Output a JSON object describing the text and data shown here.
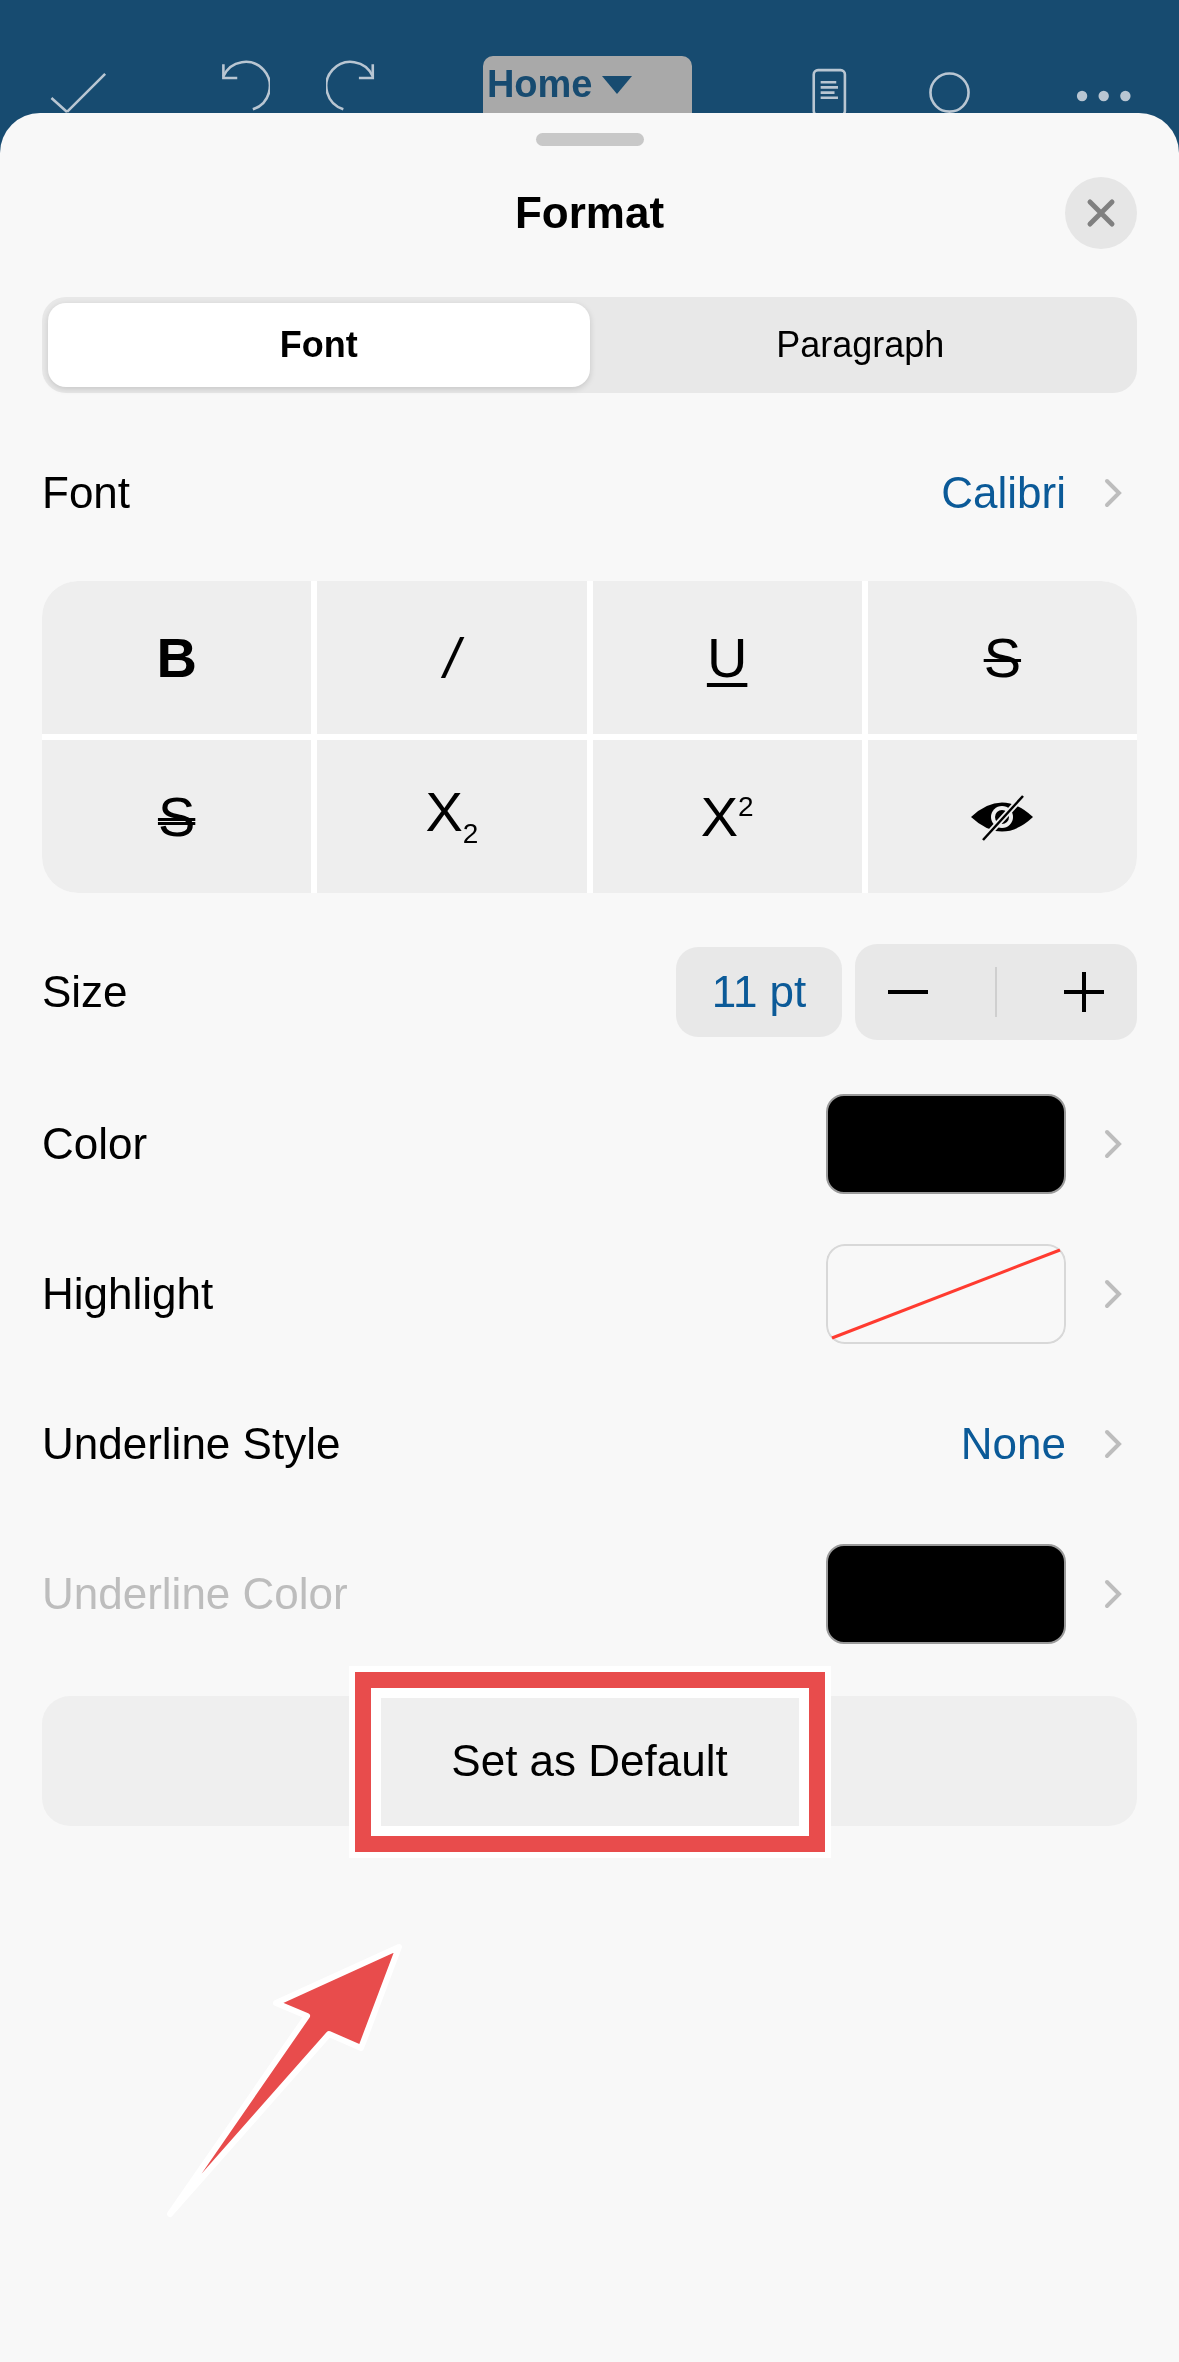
{
  "toolbar": {
    "menu": {
      "label": "Home"
    }
  },
  "sheet": {
    "title": "Format",
    "tabs": [
      {
        "label": "Font",
        "selected": true
      },
      {
        "label": "Paragraph",
        "selected": false
      }
    ],
    "font": {
      "label": "Font",
      "value": "Calibri"
    },
    "style_buttons": [
      {
        "kind": "bold",
        "label": "B"
      },
      {
        "kind": "italic",
        "label": "/"
      },
      {
        "kind": "underline",
        "label": "U"
      },
      {
        "kind": "strike",
        "label": "S"
      },
      {
        "kind": "double-strike",
        "label": "S"
      },
      {
        "kind": "script",
        "label": "X$_{2}$"
      },
      {
        "kind": "script",
        "label": "X$^{2}$"
      },
      {
        "kind": "hidden"
      }
    ],
    "size": {
      "label": "Size",
      "value": "11 pt"
    },
    "rows": [
      {
        "kind": "swatch",
        "label": "Color",
        "color": "#000000",
        "disabled": false
      },
      {
        "kind": "no-color",
        "label": "Highlight",
        "disabled": false
      },
      {
        "kind": "value",
        "label": "Underline Style",
        "value": "None",
        "disabled": false
      },
      {
        "kind": "swatch",
        "label": "Underline Color",
        "color": "#000000",
        "disabled": true
      }
    ],
    "default_button": {
      "label": "Set as Default"
    }
  }
}
